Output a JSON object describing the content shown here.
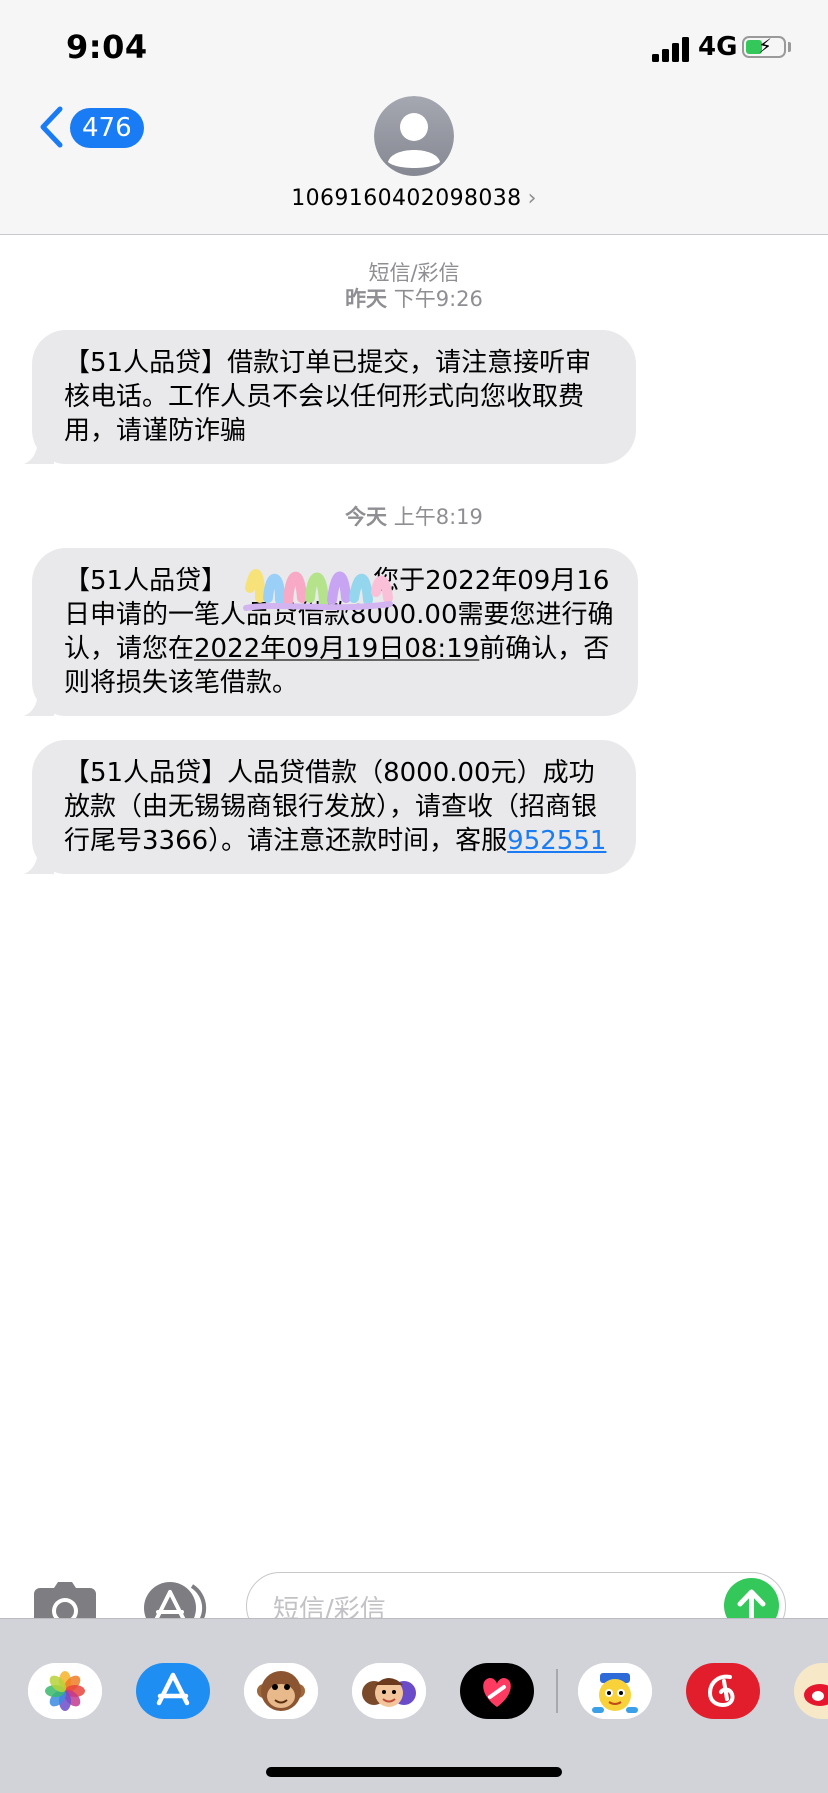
{
  "status_bar": {
    "time": "9:04",
    "network": "4G"
  },
  "nav": {
    "back_count": "476",
    "contact": "1069160402098038",
    "contact_chevron": "›"
  },
  "conversation": {
    "header_type": "短信/彩信",
    "groups": [
      {
        "timestamp_day": "昨天",
        "timestamp_time": "下午9:26"
      },
      {
        "timestamp_day": "今天",
        "timestamp_time": "上午8:19"
      }
    ],
    "messages": [
      {
        "text": "【51人品贷】借款订单已提交，请注意接听审核电话。工作人员不会以任何形式向您收取费用，请谨防诈骗"
      },
      {
        "part1": "【51人品贷】",
        "part2": "您于2022年09月16日申请的一笔人品贷借款8000.00需要您进行确认，请您在",
        "deadline": "2022年09月19日08:19",
        "part3": "前确认，否则将损失该笔借款。"
      },
      {
        "text": "【51人品贷】人品贷借款（8000.00元）成功放款（由无锡锡商银行发放），请查收（招商银行尾号3366）。请注意还款时间，客服",
        "phone": "952551"
      }
    ]
  },
  "composer": {
    "placeholder": "短信/彩信"
  },
  "app_drawer": {
    "apps": [
      "photos-icon",
      "app-store-icon",
      "monkey-memoji-icon",
      "memoji-stickers-icon",
      "digital-touch-icon",
      "cartoon-sticker-icon",
      "netease-music-icon",
      "weibo-icon"
    ]
  },
  "colors": {
    "accent": "#1a7cf5",
    "send": "#34c759",
    "bubble": "#e9e9eb"
  }
}
